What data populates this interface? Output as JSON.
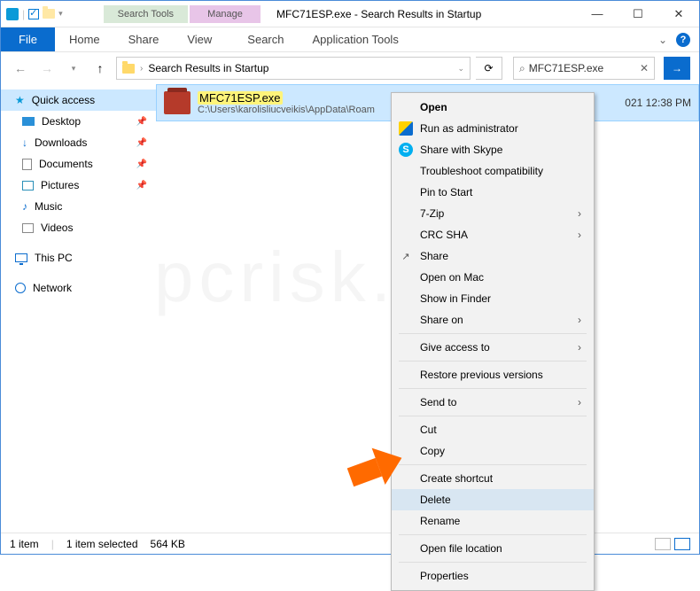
{
  "titlebar": {
    "ctx_search": "Search Tools",
    "ctx_manage": "Manage",
    "title": "MFC71ESP.exe - Search Results in Startup",
    "min": "—",
    "max": "☐",
    "close": "✕"
  },
  "menu": {
    "file": "File",
    "home": "Home",
    "share": "Share",
    "view": "View",
    "search": "Search",
    "apptools": "Application Tools"
  },
  "nav": {
    "back": "←",
    "fwd": "→",
    "up": "↑",
    "location": "Search Results in Startup",
    "refresh": "⟳",
    "search_value": "MFC71ESP.exe",
    "clear": "✕",
    "go": "→"
  },
  "sidebar": {
    "quick": "Quick access",
    "desktop": "Desktop",
    "downloads": "Downloads",
    "documents": "Documents",
    "pictures": "Pictures",
    "music": "Music",
    "videos": "Videos",
    "thispc": "This PC",
    "network": "Network"
  },
  "result": {
    "name": "MFC71ESP.exe",
    "path": "C:\\Users\\karolisliucveikis\\AppData\\Roam",
    "date": "021 12:38 PM"
  },
  "ctx": {
    "open": "Open",
    "runadmin": "Run as administrator",
    "skype": "Share with Skype",
    "troubleshoot": "Troubleshoot compatibility",
    "pin": "Pin to Start",
    "sevenzip": "7-Zip",
    "crcsha": "CRC SHA",
    "share": "Share",
    "openmac": "Open on Mac",
    "finder": "Show in Finder",
    "shareon": "Share on",
    "giveaccess": "Give access to",
    "restore": "Restore previous versions",
    "sendto": "Send to",
    "cut": "Cut",
    "copy": "Copy",
    "shortcut": "Create shortcut",
    "delete": "Delete",
    "rename": "Rename",
    "openloc": "Open file location",
    "properties": "Properties"
  },
  "status": {
    "count": "1 item",
    "selected": "1 item selected",
    "size": "564 KB"
  }
}
